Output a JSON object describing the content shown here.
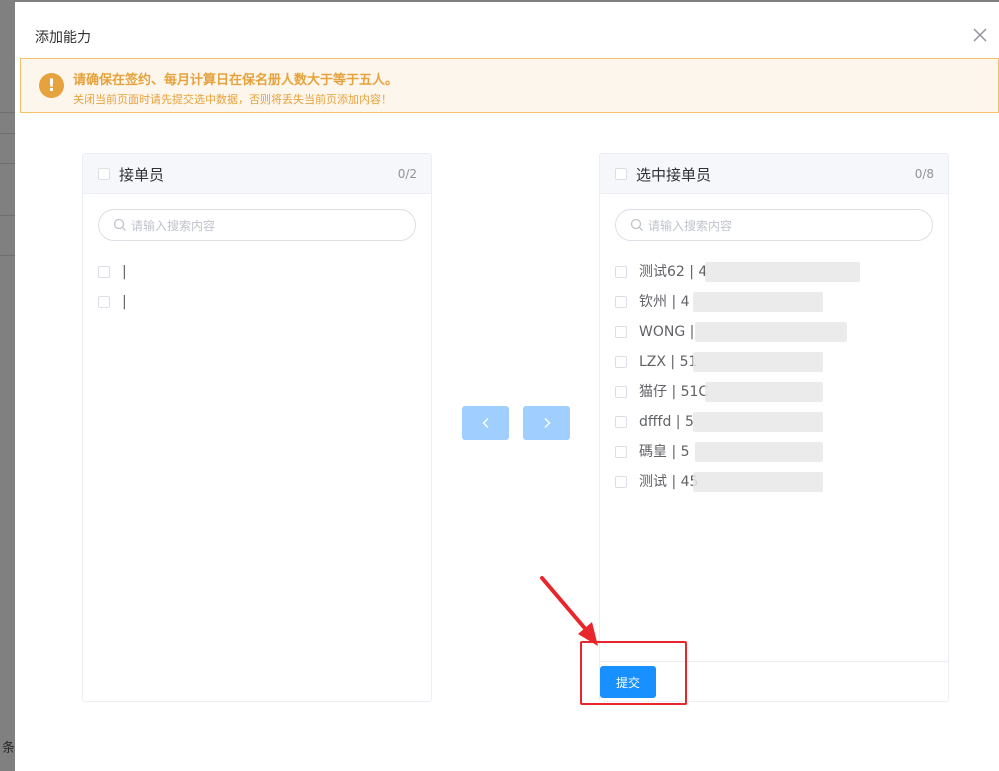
{
  "backdrop": {
    "text": "条"
  },
  "dialog": {
    "title": "添加能力",
    "alert": {
      "title": "请确保在签约、每月计算日在保名册人数大于等于五人。",
      "description": "关闭当前页面时请先提交选中数据，否则将丢失当前页添加内容！"
    },
    "left_panel": {
      "title": "接单员",
      "count": "0/2",
      "search_placeholder": "请输入搜索内容",
      "items": [
        {
          "label": "|"
        },
        {
          "label": "|"
        }
      ]
    },
    "right_panel": {
      "title": "选中接单员",
      "count": "0/8",
      "search_placeholder": "请输入搜索内容",
      "items": [
        {
          "label": "测试62 | 4"
        },
        {
          "label": "钦州 | 4"
        },
        {
          "label": "WONG |"
        },
        {
          "label": "LZX | 51"
        },
        {
          "label": "猫仔 | 51C"
        },
        {
          "label": "dfffd | 5"
        },
        {
          "label": "碼皇 | 5"
        },
        {
          "label": "测试 | 45"
        }
      ]
    },
    "buttons": {
      "move_left_icon": "chevron-left-icon",
      "move_right_icon": "chevron-right-icon",
      "submit_label": "提交"
    }
  },
  "colors": {
    "primary": "#1890ff",
    "transfer_button": "#a0cfff",
    "warning": "#e6a23c",
    "annotation": "#e8262c"
  }
}
